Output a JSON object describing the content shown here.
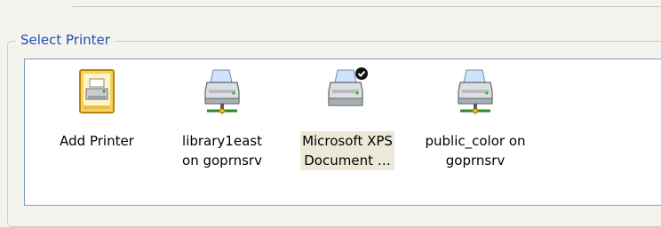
{
  "dialog": {
    "group_title": "Select Printer"
  },
  "printers": [
    {
      "label": "Add Printer",
      "icon": "add-printer-icon",
      "selected": false
    },
    {
      "label": "library1east\non goprnsrv",
      "icon": "network-printer-icon",
      "selected": false
    },
    {
      "label": "Microsoft XPS\nDocument …",
      "icon": "default-printer-icon",
      "selected": true
    },
    {
      "label": "public_color on\ngoprnsrv",
      "icon": "network-printer-icon",
      "selected": false
    }
  ],
  "colors": {
    "group_title": "#1f4fb3",
    "list_border": "#7f9db9",
    "selection": "#ece9d8"
  }
}
